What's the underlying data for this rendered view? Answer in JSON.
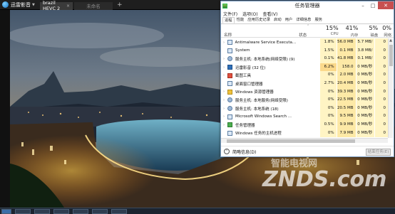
{
  "player": {
    "app_name": "迅雷影音",
    "tabs": [
      {
        "label": "brazil HEVC 2",
        "close": "×"
      },
      {
        "label": "未命名"
      }
    ],
    "add_tab": "+"
  },
  "watermark": {
    "text_cn": "智能电视网",
    "text_en": "ZNDS.com"
  },
  "task_manager": {
    "title": "任务管理器",
    "controls": {
      "minimize": "–",
      "maximize": "□",
      "close": "✕"
    },
    "menu": [
      "文件(F)",
      "选项(O)",
      "查看(V)"
    ],
    "tabs": [
      "进程",
      "性能",
      "应用历史记录",
      "启动",
      "用户",
      "详细信息",
      "服务"
    ],
    "active_tab": "进程",
    "columns": {
      "name": "名称",
      "status": "状态",
      "cpu": {
        "pct": "15%",
        "label": "CPU"
      },
      "mem": {
        "pct": "41%",
        "label": "内存"
      },
      "disk": {
        "pct": "5%",
        "label": "磁盘"
      },
      "net": {
        "pct": "0%",
        "label": "网络"
      }
    },
    "processes": [
      {
        "name": "Antimalware Service Executa...",
        "cpu": "1.8%",
        "mem": "56.0 MB",
        "disk": "5.7 MB/秒",
        "net": "0 Mbps",
        "icon": "default",
        "expand": "›",
        "hot": false
      },
      {
        "name": "System",
        "cpu": "1.5%",
        "mem": "0.1 MB",
        "disk": "3.8 MB/秒",
        "net": "0 Mbps",
        "icon": "default",
        "expand": "",
        "hot": false
      },
      {
        "name": "服务主机: 本地系统(网络受限) (9)",
        "cpu": "0.1%",
        "mem": "41.8 MB",
        "disk": "0.1 MB/秒",
        "net": "0 Mbps",
        "icon": "gear",
        "expand": "›",
        "hot": false
      },
      {
        "name": "迅雷影音 (32 位)",
        "cpu": "6.2%",
        "mem": "158.0 MB",
        "disk": "0 MB/秒",
        "net": "0 Mbps",
        "icon": "blue",
        "expand": "›",
        "hot": true
      },
      {
        "name": "截图工具",
        "cpu": "0%",
        "mem": "2.0 MB",
        "disk": "0 MB/秒",
        "net": "0 Mbps",
        "icon": "red",
        "expand": "›",
        "hot": false
      },
      {
        "name": "桌面窗口管理器",
        "cpu": "2.7%",
        "mem": "20.4 MB",
        "disk": "0 MB/秒",
        "net": "0 Mbps",
        "icon": "default",
        "expand": "",
        "hot": false
      },
      {
        "name": "Windows 资源管理器",
        "cpu": "0%",
        "mem": "39.3 MB",
        "disk": "0 MB/秒",
        "net": "0 Mbps",
        "icon": "yellow",
        "expand": "›",
        "hot": false
      },
      {
        "name": "服务主机: 本地服务(网络受限)",
        "cpu": "0%",
        "mem": "22.5 MB",
        "disk": "0 MB/秒",
        "net": "0 Mbps",
        "icon": "gear",
        "expand": "›",
        "hot": false
      },
      {
        "name": "服务主机: 本地系统 (18)",
        "cpu": "0%",
        "mem": "20.5 MB",
        "disk": "0 MB/秒",
        "net": "0 Mbps",
        "icon": "gear",
        "expand": "›",
        "hot": false
      },
      {
        "name": "Microsoft Windows Search ...",
        "cpu": "0%",
        "mem": "9.5 MB",
        "disk": "0 MB/秒",
        "net": "0 Mbps",
        "icon": "default",
        "expand": "›",
        "hot": false
      },
      {
        "name": "任务管理器",
        "cpu": "0.5%",
        "mem": "9.9 MB",
        "disk": "0 MB/秒",
        "net": "0 Mbps",
        "icon": "green",
        "expand": "›",
        "hot": false
      },
      {
        "name": "Windows 任务的主机进程",
        "cpu": "0%",
        "mem": "7.9 MB",
        "disk": "0 MB/秒",
        "net": "0 Mbps",
        "icon": "default",
        "expand": "",
        "hot": false
      }
    ],
    "footer": {
      "less_details": "简略信息(D)",
      "end_task": "结束任务(E)"
    }
  },
  "colors": {
    "accent": "#1473c5",
    "close_button": "#c75050",
    "cpu_fill": "#fff4c4",
    "mem_fill": "#fde9a6"
  }
}
